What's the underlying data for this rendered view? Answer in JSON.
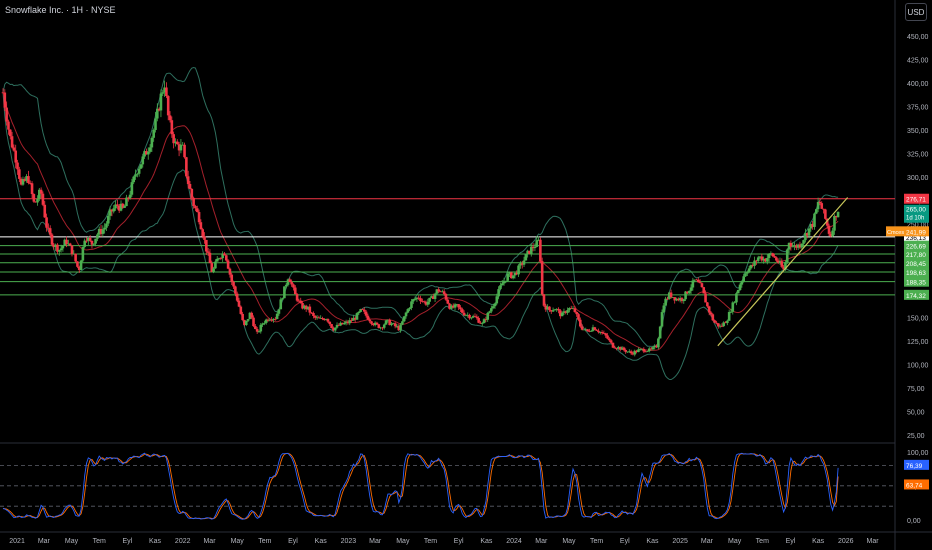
{
  "header": {
    "title": "Snowflake Inc. · 1H · NYSE",
    "currency_button": "USD"
  },
  "colors": {
    "background": "#000000",
    "up": "#26a69a",
    "candle_up": "#4caf50",
    "candle_down": "#f23645",
    "bb_band": "#2e6f5e",
    "bb_basis": "#a4202b",
    "support": "#4caf50",
    "resistance": "#f23645",
    "trendline": "#c8c65a",
    "stoch_k": "#2962ff",
    "stoch_d": "#ff6d00",
    "grid_text": "#b2b5be"
  },
  "chart_data": [
    {
      "type": "candlestick",
      "title": "Snowflake Inc. · 1H · NYSE",
      "y_ticks": [
        "450,00",
        "425,00",
        "400,00",
        "375,00",
        "350,00",
        "325,00",
        "300,00",
        "275,00",
        "250,00",
        "225,00",
        "200,00",
        "175,00",
        "150,00",
        "125,00",
        "100,00",
        "75,00",
        "50,00",
        "25,00"
      ],
      "y_tick_values": [
        450,
        425,
        400,
        375,
        350,
        325,
        300,
        275,
        250,
        225,
        200,
        175,
        150,
        125,
        100,
        75,
        50,
        25
      ],
      "ylim": [
        25,
        465
      ],
      "x_ticks": [
        "2021",
        "Mar",
        "May",
        "Tem",
        "Eyl",
        "Kas",
        "2022",
        "Mar",
        "May",
        "Tem",
        "Eyl",
        "Kas",
        "2023",
        "Mar",
        "May",
        "Tem",
        "Eyl",
        "Kas",
        "2024",
        "Mar",
        "May",
        "Tem",
        "Eyl",
        "Kas",
        "2025",
        "Mar",
        "May",
        "Tem",
        "Eyl",
        "Kas",
        "2026",
        "Mar"
      ],
      "horizontal_levels": [
        {
          "value": 276.71,
          "label": "276,71",
          "kind": "resistance"
        },
        {
          "value": 236.13,
          "label": "236,13",
          "kind": "support-white"
        },
        {
          "value": 226.69,
          "label": "226,69",
          "kind": "support"
        },
        {
          "value": 217.8,
          "label": "217,80",
          "kind": "support"
        },
        {
          "value": 208.45,
          "label": "208,45",
          "kind": "support"
        },
        {
          "value": 198.63,
          "label": "198,63",
          "kind": "support"
        },
        {
          "value": 188.35,
          "label": "188,35",
          "kind": "support"
        },
        {
          "value": 174.32,
          "label": "174,32",
          "kind": "support"
        }
      ],
      "price_badge": {
        "value": 265.0,
        "label": "265,00",
        "countdown": "1d 10h"
      },
      "alert_badge": {
        "value": 241.99,
        "tag": "Cmcest",
        "label": "241,99"
      },
      "trendline": {
        "from": {
          "t": "2025-03-25",
          "v": 120
        },
        "to": {
          "t": "2026-01-05",
          "v": 278
        }
      },
      "closes": [
        [
          "2020-12-01",
          390
        ],
        [
          "2020-12-15",
          345
        ],
        [
          "2021-01-01",
          315
        ],
        [
          "2021-01-10",
          290
        ],
        [
          "2021-01-25",
          300
        ],
        [
          "2021-02-08",
          270
        ],
        [
          "2021-02-22",
          285
        ],
        [
          "2021-03-08",
          245
        ],
        [
          "2021-03-22",
          228
        ],
        [
          "2021-04-05",
          222
        ],
        [
          "2021-04-19",
          232
        ],
        [
          "2021-05-03",
          220
        ],
        [
          "2021-05-17",
          200
        ],
        [
          "2021-05-31",
          238
        ],
        [
          "2021-06-14",
          228
        ],
        [
          "2021-06-28",
          240
        ],
        [
          "2021-07-12",
          245
        ],
        [
          "2021-07-26",
          262
        ],
        [
          "2021-08-09",
          270
        ],
        [
          "2021-08-23",
          265
        ],
        [
          "2021-09-06",
          282
        ],
        [
          "2021-09-20",
          305
        ],
        [
          "2021-10-04",
          318
        ],
        [
          "2021-10-18",
          332
        ],
        [
          "2021-11-01",
          355
        ],
        [
          "2021-11-15",
          388
        ],
        [
          "2021-11-22",
          400
        ],
        [
          "2021-12-01",
          360
        ],
        [
          "2021-12-15",
          335
        ],
        [
          "2022-01-01",
          330
        ],
        [
          "2022-01-10",
          300
        ],
        [
          "2022-01-24",
          272
        ],
        [
          "2022-02-07",
          255
        ],
        [
          "2022-02-21",
          225
        ],
        [
          "2022-03-07",
          198
        ],
        [
          "2022-03-21",
          215
        ],
        [
          "2022-04-04",
          220
        ],
        [
          "2022-04-18",
          190
        ],
        [
          "2022-05-02",
          168
        ],
        [
          "2022-05-16",
          140
        ],
        [
          "2022-05-30",
          155
        ],
        [
          "2022-06-13",
          132
        ],
        [
          "2022-06-27",
          145
        ],
        [
          "2022-07-11",
          150
        ],
        [
          "2022-07-25",
          150
        ],
        [
          "2022-08-08",
          172
        ],
        [
          "2022-08-22",
          195
        ],
        [
          "2022-09-05",
          175
        ],
        [
          "2022-09-19",
          162
        ],
        [
          "2022-10-03",
          160
        ],
        [
          "2022-10-17",
          150
        ],
        [
          "2022-10-31",
          148
        ],
        [
          "2022-11-14",
          150
        ],
        [
          "2022-11-28",
          138
        ],
        [
          "2022-12-12",
          142
        ],
        [
          "2023-01-01",
          145
        ],
        [
          "2023-01-16",
          150
        ],
        [
          "2023-01-30",
          158
        ],
        [
          "2023-02-13",
          150
        ],
        [
          "2023-02-27",
          143
        ],
        [
          "2023-03-13",
          140
        ],
        [
          "2023-03-27",
          146
        ],
        [
          "2023-04-10",
          142
        ],
        [
          "2023-04-24",
          138
        ],
        [
          "2023-05-08",
          155
        ],
        [
          "2023-05-22",
          168
        ],
        [
          "2023-06-05",
          172
        ],
        [
          "2023-06-19",
          165
        ],
        [
          "2023-07-03",
          170
        ],
        [
          "2023-07-17",
          180
        ],
        [
          "2023-07-31",
          175
        ],
        [
          "2023-08-14",
          160
        ],
        [
          "2023-08-28",
          162
        ],
        [
          "2023-09-11",
          155
        ],
        [
          "2023-09-25",
          152
        ],
        [
          "2023-10-09",
          150
        ],
        [
          "2023-10-23",
          143
        ],
        [
          "2023-11-06",
          155
        ],
        [
          "2023-11-20",
          168
        ],
        [
          "2023-12-04",
          185
        ],
        [
          "2023-12-18",
          195
        ],
        [
          "2024-01-01",
          195
        ],
        [
          "2024-01-15",
          205
        ],
        [
          "2024-02-05",
          222
        ],
        [
          "2024-02-26",
          232
        ],
        [
          "2024-03-04",
          165
        ],
        [
          "2024-03-18",
          158
        ],
        [
          "2024-04-01",
          160
        ],
        [
          "2024-04-15",
          152
        ],
        [
          "2024-04-29",
          160
        ],
        [
          "2024-05-13",
          158
        ],
        [
          "2024-05-27",
          140
        ],
        [
          "2024-06-10",
          135
        ],
        [
          "2024-06-24",
          140
        ],
        [
          "2024-07-08",
          135
        ],
        [
          "2024-07-22",
          130
        ],
        [
          "2024-08-05",
          120
        ],
        [
          "2024-08-19",
          118
        ],
        [
          "2024-09-02",
          115
        ],
        [
          "2024-09-16",
          112
        ],
        [
          "2024-09-30",
          115
        ],
        [
          "2024-10-14",
          116
        ],
        [
          "2024-10-28",
          115
        ],
        [
          "2024-11-11",
          120
        ],
        [
          "2024-11-25",
          165
        ],
        [
          "2024-12-09",
          175
        ],
        [
          "2024-12-23",
          170
        ],
        [
          "2025-01-06",
          170
        ],
        [
          "2025-01-20",
          180
        ],
        [
          "2025-02-03",
          190
        ],
        [
          "2025-02-17",
          182
        ],
        [
          "2025-03-03",
          160
        ],
        [
          "2025-03-17",
          145
        ],
        [
          "2025-03-31",
          140
        ],
        [
          "2025-04-14",
          148
        ],
        [
          "2025-04-28",
          165
        ],
        [
          "2025-05-12",
          185
        ],
        [
          "2025-05-26",
          200
        ],
        [
          "2025-06-09",
          205
        ],
        [
          "2025-06-23",
          215
        ],
        [
          "2025-07-07",
          212
        ],
        [
          "2025-07-21",
          218
        ],
        [
          "2025-08-04",
          210
        ],
        [
          "2025-08-18",
          200
        ],
        [
          "2025-08-28",
          232
        ],
        [
          "2025-09-08",
          225
        ],
        [
          "2025-09-22",
          228
        ],
        [
          "2025-10-06",
          240
        ],
        [
          "2025-10-20",
          250
        ],
        [
          "2025-11-03",
          275
        ],
        [
          "2025-11-17",
          255
        ],
        [
          "2025-11-28",
          236
        ],
        [
          "2025-12-08",
          258
        ],
        [
          "2025-12-15",
          265
        ]
      ]
    },
    {
      "type": "line",
      "title": "Stochastic",
      "y_ticks": [
        "100,00",
        "50,00",
        "0,00"
      ],
      "y_tick_values": [
        100,
        50,
        0
      ],
      "ylim": [
        -15,
        110
      ],
      "dashed_levels": [
        80,
        50,
        20
      ],
      "series": [
        {
          "key": "k",
          "badge": "76,39",
          "last": 76.39
        },
        {
          "key": "d",
          "badge": "63,74",
          "last": 63.74
        }
      ]
    }
  ]
}
